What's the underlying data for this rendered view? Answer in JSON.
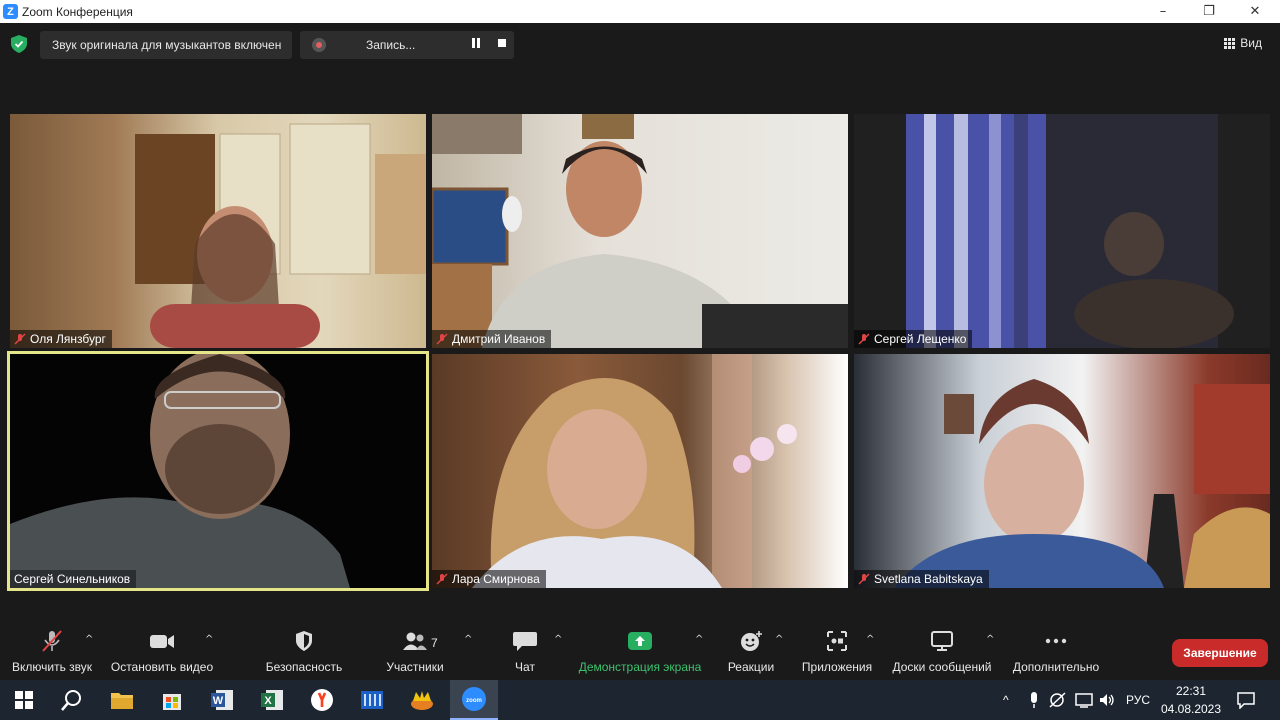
{
  "window": {
    "title": "Zoom Конференция",
    "app_logo_letter": "Z",
    "minimize_glyph": "–",
    "maximize_glyph": "❐",
    "close_glyph": "✕"
  },
  "topbar": {
    "audio_notice": "Звук оригинала для музыкантов включен",
    "recording_label": "Запись...",
    "view_label": "Вид"
  },
  "participants": [
    {
      "name": "Оля Лянзбург",
      "muted": true
    },
    {
      "name": "Дмитрий Иванов",
      "muted": true
    },
    {
      "name": "Сергей Лещенко",
      "muted": true
    },
    {
      "name": "Сергей Синельников",
      "muted": false,
      "active_speaker": true
    },
    {
      "name": "Лара Смирнова",
      "muted": true
    },
    {
      "name": "Svetlana Babitskaya",
      "muted": true
    }
  ],
  "toolbar": {
    "mute_label": "Включить звук",
    "video_label": "Остановить видео",
    "security_label": "Безопасность",
    "participants_label": "Участники",
    "participants_count": "7",
    "chat_label": "Чат",
    "share_label": "Демонстрация экрана",
    "reactions_label": "Реакции",
    "apps_label": "Приложения",
    "whiteboards_label": "Доски сообщений",
    "more_label": "Дополнительно",
    "end_label": "Завершение",
    "caret_glyph": "^"
  },
  "taskbar": {
    "language": "РУС",
    "time": "22:31",
    "date": "04.08.2023",
    "up_glyph": "^"
  },
  "colors": {
    "share_green": "#27ae60",
    "end_red": "#c92a2a",
    "speaker_outline": "#e6e58a",
    "zoom_blue": "#2d8cff"
  }
}
